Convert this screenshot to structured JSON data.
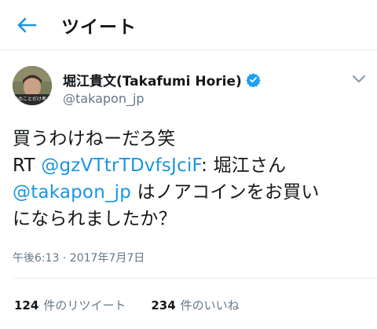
{
  "header": {
    "title": "ツイート",
    "back_icon": "back-arrow-icon"
  },
  "author": {
    "name": "堀江貴文(Takafumi Horie)",
    "handle": "@takapon_jp",
    "verified": true,
    "avatar_caption": "分のことだけ考え"
  },
  "tweet": {
    "line1": "買うわけねーだろ笑",
    "rt_prefix": "RT ",
    "rt_mention": "@gzVTtrTDvfsJciF",
    "rt_text": ": 堀江さん",
    "mention2": "@takapon_jp",
    "line3_text": " はノアコインをお買い",
    "line4": "になられましたか？"
  },
  "meta": {
    "timestamp": "午後6:13 · 2017年7月7日"
  },
  "stats": {
    "retweets_count": "124",
    "retweets_label": "件のリツイート",
    "likes_count": "234",
    "likes_label": "件のいいね"
  },
  "colors": {
    "accent": "#1b95e0",
    "muted": "#657786",
    "text": "#14171a"
  }
}
